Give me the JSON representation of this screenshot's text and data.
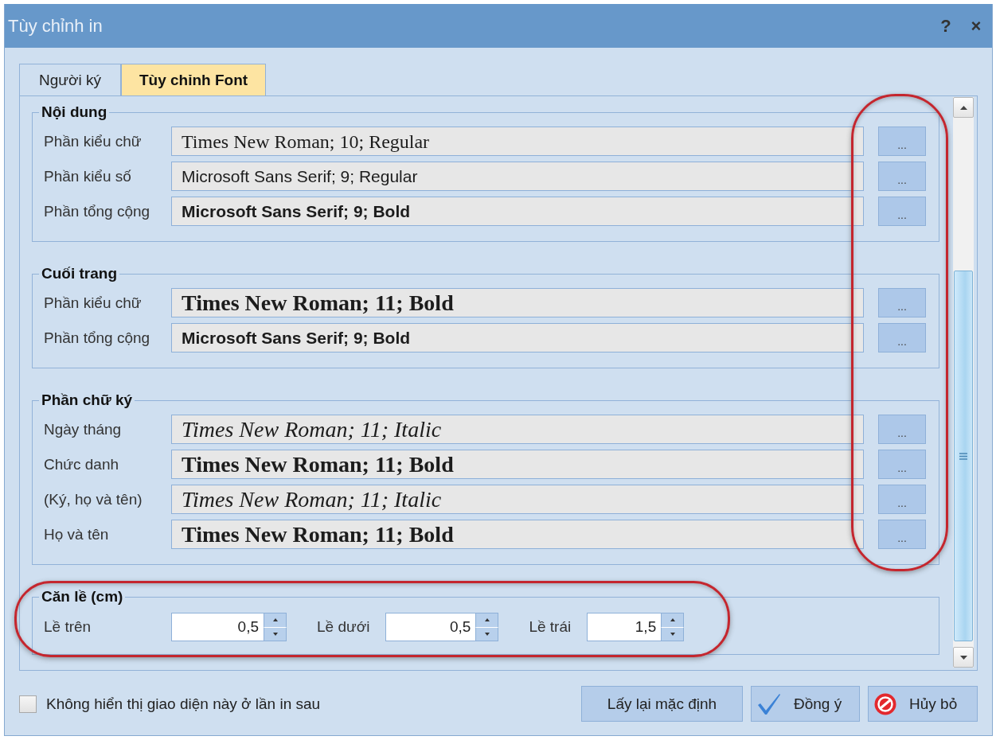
{
  "window": {
    "title": "Tùy chỉnh in",
    "help_button": "?",
    "close_button": "×"
  },
  "tabs": [
    {
      "label": "Người ký",
      "selected": false
    },
    {
      "label": "Tùy chỉnh Font",
      "selected": true
    }
  ],
  "font_groups": [
    {
      "title": "Nội dung",
      "rows": [
        {
          "label": "Phần kiểu chữ",
          "value": "Times New Roman; 10; Regular",
          "kind": "serif",
          "button": "..."
        },
        {
          "label": "Phần kiểu số",
          "value": "Microsoft Sans Serif; 9; Regular",
          "kind": "sans",
          "button": "..."
        },
        {
          "label": "Phần tổng cộng",
          "value": "Microsoft Sans Serif; 9; Bold",
          "kind": "sansbold",
          "button": "..."
        }
      ]
    },
    {
      "title": "Cuối trang",
      "rows": [
        {
          "label": "Phần kiểu chữ",
          "value": "Times New Roman; 11; Bold",
          "kind": "serifbold",
          "button": "..."
        },
        {
          "label": "Phần tổng cộng",
          "value": "Microsoft Sans Serif; 9; Bold",
          "kind": "sansbold",
          "button": "..."
        }
      ]
    },
    {
      "title": "Phần chữ ký",
      "rows": [
        {
          "label": "Ngày tháng",
          "value": "Times New Roman; 11; Italic",
          "kind": "serifitalic",
          "button": "..."
        },
        {
          "label": "Chức danh",
          "value": "Times New Roman; 11; Bold",
          "kind": "serifbold",
          "button": "..."
        },
        {
          "label": "(Ký, họ và tên)",
          "value": "Times New Roman; 11; Italic",
          "kind": "serifitalic",
          "button": "..."
        },
        {
          "label": "Họ và tên",
          "value": "Times New Roman; 11; Bold",
          "kind": "serifbold",
          "button": "..."
        }
      ]
    }
  ],
  "margins": {
    "title": "Căn lề (cm)",
    "fields": [
      {
        "label": "Lề trên",
        "value": "0,5"
      },
      {
        "label": "Lề dưới",
        "value": "0,5"
      },
      {
        "label": "Lề trái",
        "value": "1,5"
      }
    ]
  },
  "checkbox": {
    "label": "Không hiển thị giao diện này ở lần in sau",
    "checked": false
  },
  "buttons": [
    {
      "label": "Lấy lại mặc định",
      "kind": "plain"
    },
    {
      "label": "Đồng ý",
      "kind": "confirm"
    },
    {
      "label": "Hủy bỏ",
      "kind": "cancel"
    }
  ],
  "annotations": {
    "browse_buttons_circled": true,
    "margins_circled": true
  }
}
